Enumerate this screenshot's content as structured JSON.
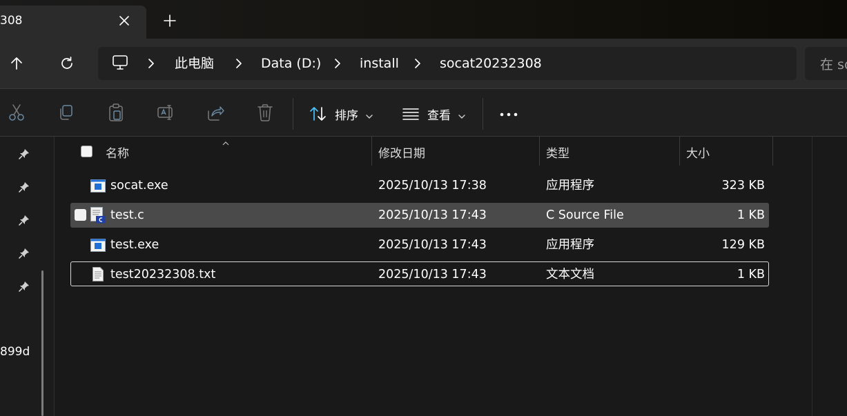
{
  "window": {
    "tab_title": "308",
    "tab_close_icon": "close-icon",
    "new_tab_icon": "plus-icon"
  },
  "nav": {
    "up_icon": "arrow-up-icon",
    "refresh_icon": "refresh-icon",
    "breadcrumb": [
      {
        "label": "此电脑"
      },
      {
        "label": "Data (D:)"
      },
      {
        "label": "install"
      },
      {
        "label": "socat20232308"
      }
    ],
    "pc_icon": "monitor-icon",
    "search_placeholder": "在 so"
  },
  "toolbar": {
    "icons": [
      "cut-icon",
      "copy-icon",
      "paste-icon",
      "rename-icon",
      "share-icon",
      "delete-icon"
    ],
    "sort_label": "排序",
    "view_label": "查看",
    "more_icon": "more-icon"
  },
  "sidebar": {
    "pins": 5,
    "partial_text": "899d"
  },
  "columns": {
    "name": "名称",
    "modified": "修改日期",
    "type": "类型",
    "size": "大小"
  },
  "files": [
    {
      "name": "socat.exe",
      "modified": "2025/10/13 17:38",
      "type": "应用程序",
      "size": "323 KB",
      "icon": "exe-icon"
    },
    {
      "name": "test.c",
      "modified": "2025/10/13 17:43",
      "type": "C Source File",
      "size": "1 KB",
      "icon": "c-source-icon",
      "state": "selected"
    },
    {
      "name": "test.exe",
      "modified": "2025/10/13 17:43",
      "type": "应用程序",
      "size": "129 KB",
      "icon": "exe-icon"
    },
    {
      "name": "test20232308.txt",
      "modified": "2025/10/13 17:43",
      "type": "文本文档",
      "size": "1 KB",
      "icon": "text-file-icon",
      "state": "focused"
    }
  ],
  "colors": {
    "background": "#191919",
    "panel": "#2b2b2b",
    "selected_row": "#4a4a4a",
    "accent": "#4cc2ff"
  }
}
